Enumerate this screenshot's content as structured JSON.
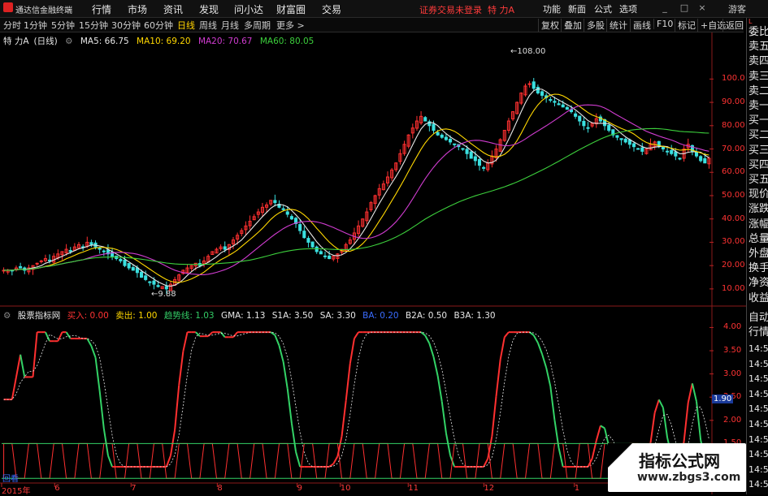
{
  "app": {
    "title": "通达信金融终端",
    "menu": [
      "行情",
      "市场",
      "资讯",
      "发现",
      "问小达",
      "财富圈",
      "交易"
    ],
    "status": "证券交易未登录",
    "stock_title": "特 力A",
    "right_menu": [
      "功能",
      "新面",
      "公式",
      "选项"
    ],
    "guest": "游客",
    "win_buttons": [
      "_",
      "□",
      "×"
    ]
  },
  "toolbar": {
    "timeframes": [
      "分时",
      "1分钟",
      "5分钟",
      "15分钟",
      "30分钟",
      "60分钟",
      "日线",
      "周线",
      "月线",
      "多周期",
      "更多 >"
    ],
    "active": "日线",
    "right_tools": [
      "复权",
      "叠加",
      "多股",
      "统计",
      "画线",
      "F10",
      "标记",
      "+自选",
      "返回"
    ]
  },
  "legend": {
    "stock": "特 力A",
    "period": "(日线)",
    "items": [
      {
        "label": "MA5: 66.75",
        "color": "#e8e8e8"
      },
      {
        "label": "MA10: 69.20",
        "color": "#ffd700"
      },
      {
        "label": "MA20: 70.67",
        "color": "#d03cd0"
      },
      {
        "label": "MA60: 80.05",
        "color": "#3ccf3c"
      }
    ]
  },
  "price_axis": {
    "labels": [
      "100.0",
      "90.00",
      "80.00",
      "70.00",
      "60.00",
      "50.00",
      "40.00",
      "30.00",
      "20.00",
      "10.00"
    ],
    "values": [
      100,
      90,
      80,
      70,
      60,
      50,
      40,
      30,
      20,
      10
    ],
    "ymin": 3,
    "ymax": 113
  },
  "annotations": {
    "high": "108.00",
    "low": "9.88"
  },
  "indicator": {
    "name": "股票指标网",
    "items": [
      {
        "label": "买入: 0.00",
        "color": "#ff3333"
      },
      {
        "label": "卖出: 1.00",
        "color": "#ffd700"
      },
      {
        "label": "趋势线: 1.03",
        "color": "#33cc66"
      },
      {
        "label": "GMA: 1.13",
        "color": "#e8e8e8"
      },
      {
        "label": "S1A: 3.50",
        "color": "#e8e8e8"
      },
      {
        "label": "SA: 3.30",
        "color": "#e8e8e8"
      },
      {
        "label": "BA: 0.20",
        "color": "#3a6cff"
      },
      {
        "label": "B2A: 0.50",
        "color": "#e8e8e8"
      },
      {
        "label": "B3A: 1.30",
        "color": "#e8e8e8"
      }
    ],
    "axis_labels": [
      "4.00",
      "3.50",
      "3.00",
      "2.50",
      "2.00",
      "1.50",
      "1.00"
    ],
    "axis_values": [
      4.0,
      3.5,
      3.0,
      2.5,
      2.0,
      1.5,
      1.0
    ],
    "ymin": 0.65,
    "ymax": 4.2,
    "current": "1.90",
    "bottom_text": "回看"
  },
  "dates": [
    {
      "label": "2015年",
      "pos": 0.0
    },
    {
      "label": "6",
      "pos": 0.075
    },
    {
      "label": "7",
      "pos": 0.183
    },
    {
      "label": "8",
      "pos": 0.305
    },
    {
      "label": "9",
      "pos": 0.418
    },
    {
      "label": "10",
      "pos": 0.479
    },
    {
      "label": "11",
      "pos": 0.575
    },
    {
      "label": "12",
      "pos": 0.682
    },
    {
      "label": "1",
      "pos": 0.81
    }
  ],
  "right_panel": {
    "corner": "L",
    "items": [
      "委比",
      "卖五",
      "卖四",
      "卖三",
      "卖二",
      "卖一",
      "买一",
      "买二",
      "买三",
      "买四",
      "买五",
      "现价",
      "涨跌",
      "涨幅",
      "总量",
      "外盘",
      "换手",
      "净资",
      "收益"
    ],
    "lower_items": [
      "自动",
      "行情"
    ],
    "times": [
      "14:5",
      "14:5",
      "14:5",
      "14:5",
      "14:5",
      "14:5",
      "14:5",
      "14:5",
      "14:5",
      "14:5"
    ]
  },
  "watermark": {
    "line1": "指标公式网",
    "line2": "www.zbgs3.com"
  },
  "chart_data": {
    "type": "candlestick",
    "price_series_note": "approximate closes",
    "closes": [
      18,
      18,
      18,
      19,
      19,
      18,
      19,
      20,
      21,
      22,
      23,
      22,
      24,
      25,
      26,
      27,
      26,
      28,
      29,
      28,
      30,
      29,
      28,
      27,
      26,
      25,
      24,
      23,
      22,
      20,
      19,
      18,
      17,
      15,
      14,
      13,
      12,
      11,
      11,
      10,
      12,
      14,
      16,
      18,
      19,
      20,
      21,
      20,
      22,
      24,
      26,
      27,
      28,
      27,
      29,
      31,
      33,
      35,
      37,
      39,
      41,
      43,
      45,
      46,
      48,
      47,
      45,
      44,
      42,
      40,
      38,
      35,
      32,
      30,
      28,
      26,
      25,
      24,
      23,
      24,
      25,
      27,
      29,
      31,
      34,
      37,
      40,
      43,
      47,
      50,
      53,
      55,
      58,
      61,
      64,
      68,
      72,
      76,
      79,
      82,
      84,
      82,
      80,
      78,
      76,
      75,
      74,
      73,
      72,
      71,
      70,
      68,
      66,
      65,
      63,
      62,
      64,
      67,
      70,
      74,
      78,
      82,
      86,
      90,
      94,
      97,
      98,
      96,
      94,
      93,
      92,
      91,
      90,
      89,
      88,
      87,
      86,
      84,
      82,
      80,
      79,
      81,
      83,
      82,
      80,
      78,
      76,
      75,
      74,
      73,
      72,
      71,
      70,
      69,
      70,
      72,
      73,
      71,
      70,
      69,
      68,
      67,
      66,
      70,
      72,
      69,
      67,
      65,
      64,
      66
    ],
    "ma_note": "moving averages computed from closes: MA5, MA10, MA20, MA60"
  }
}
